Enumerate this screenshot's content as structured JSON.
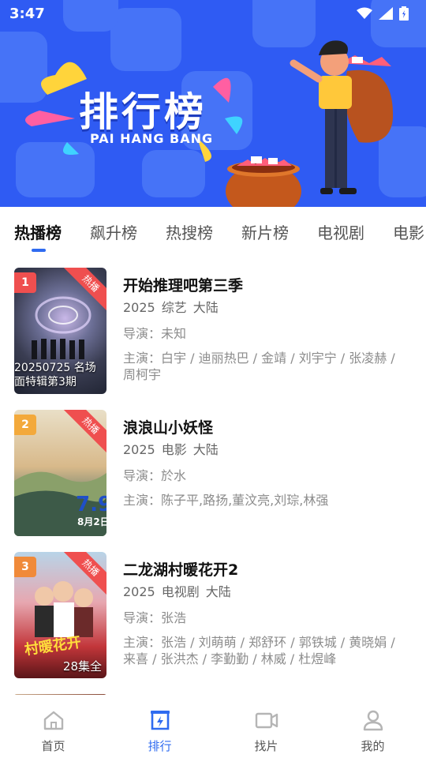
{
  "status_bar": {
    "time": "3:47"
  },
  "banner": {
    "title": "排行榜",
    "subtitle": "PAI HANG BANG"
  },
  "tabs": [
    {
      "label": "热播榜",
      "active": true
    },
    {
      "label": "飙升榜"
    },
    {
      "label": "热搜榜"
    },
    {
      "label": "新片榜"
    },
    {
      "label": "电视剧"
    },
    {
      "label": "电影"
    }
  ],
  "list": [
    {
      "rank": "1",
      "badge": "热播",
      "poster_caption": "20250725 名场面特辑第3期",
      "title": "开始推理吧第三季",
      "year": "2025",
      "genre": "综艺",
      "region": "大陆",
      "director": "导演：未知",
      "cast": "主演：白宇 / 迪丽热巴 / 金靖 / 刘宇宁 / 张凌赫 / 周柯宇"
    },
    {
      "rank": "2",
      "badge": "热播",
      "poster_caption": "",
      "title": "浪浪山小妖怪",
      "year": "2025",
      "genre": "电影",
      "region": "大陆",
      "director": "导演：於水",
      "cast": "主演：陈子平,路扬,董汶亮,刘琮,林强"
    },
    {
      "rank": "3",
      "badge": "热播",
      "poster_caption": "28集全",
      "title": "二龙湖村暖花开2",
      "year": "2025",
      "genre": "电视剧",
      "region": "大陆",
      "director": "导演：张浩",
      "cast": "主演：张浩 / 刘萌萌 / 郑舒环 / 郭铁城 / 黄晓娟 / 来喜 / 张洪杰 / 李勤勤 / 林威 / 杜煜峰"
    }
  ],
  "bottom_nav": [
    {
      "label": "首页",
      "icon": "home-icon"
    },
    {
      "label": "排行",
      "icon": "rank-icon",
      "active": true
    },
    {
      "label": "找片",
      "icon": "video-icon"
    },
    {
      "label": "我的",
      "icon": "user-icon"
    }
  ],
  "colors": {
    "banner_blue": "#2f5bf3",
    "accent": "#2f6bf0",
    "rank1": "#ef4f4f",
    "rank2": "#f3a93b",
    "rank3": "#f08a3a",
    "hot_badge": "#ef4f4f"
  }
}
